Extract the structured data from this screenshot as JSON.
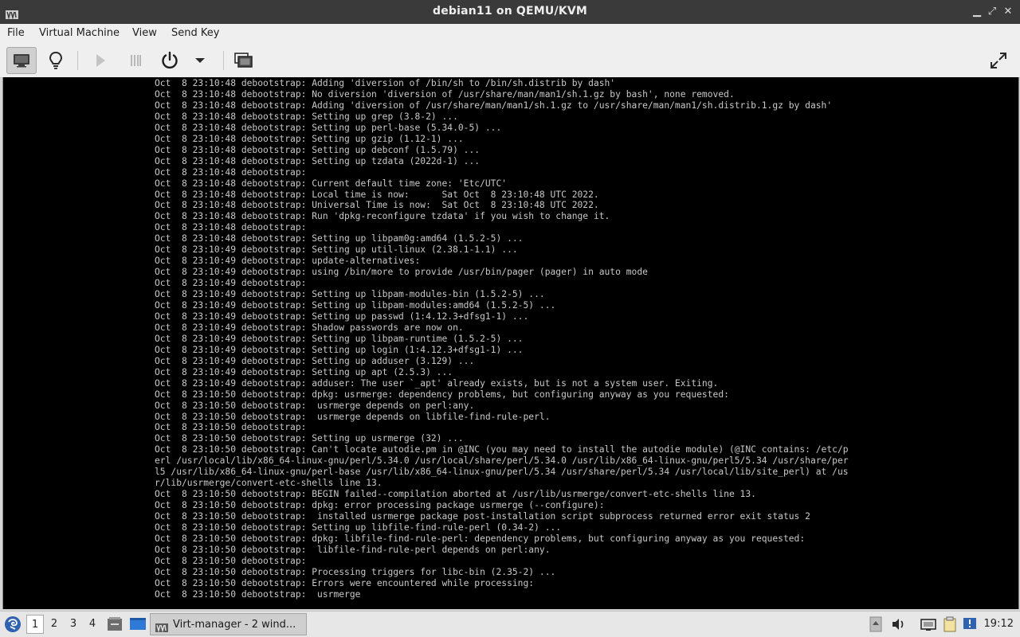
{
  "window": {
    "title": "debian11 on QEMU/KVM",
    "buttons": {
      "minimize": "▁",
      "maximize": "⤢",
      "close": "✕"
    }
  },
  "menu": [
    "File",
    "Virtual Machine",
    "View",
    "Send Key"
  ],
  "toolbar": {
    "icons": [
      "console-icon",
      "lightbulb-icon",
      "play-icon",
      "pause-icon",
      "power-icon",
      "dropdown-arrow-icon",
      "screenshot-icon",
      "fullscreen-icon"
    ]
  },
  "console": {
    "lines": [
      "Oct  8 23:10:48 debootstrap: Adding 'diversion of /bin/sh to /bin/sh.distrib by dash'",
      "Oct  8 23:10:48 debootstrap: No diversion 'diversion of /usr/share/man/man1/sh.1.gz by bash', none removed.",
      "Oct  8 23:10:48 debootstrap: Adding 'diversion of /usr/share/man/man1/sh.1.gz to /usr/share/man/man1/sh.distrib.1.gz by dash'",
      "Oct  8 23:10:48 debootstrap: Setting up grep (3.8-2) ...",
      "Oct  8 23:10:48 debootstrap: Setting up perl-base (5.34.0-5) ...",
      "Oct  8 23:10:48 debootstrap: Setting up gzip (1.12-1) ...",
      "Oct  8 23:10:48 debootstrap: Setting up debconf (1.5.79) ...",
      "Oct  8 23:10:48 debootstrap: Setting up tzdata (2022d-1) ...",
      "Oct  8 23:10:48 debootstrap:",
      "Oct  8 23:10:48 debootstrap: Current default time zone: 'Etc/UTC'",
      "Oct  8 23:10:48 debootstrap: Local time is now:      Sat Oct  8 23:10:48 UTC 2022.",
      "Oct  8 23:10:48 debootstrap: Universal Time is now:  Sat Oct  8 23:10:48 UTC 2022.",
      "Oct  8 23:10:48 debootstrap: Run 'dpkg-reconfigure tzdata' if you wish to change it.",
      "Oct  8 23:10:48 debootstrap:",
      "Oct  8 23:10:48 debootstrap: Setting up libpam0g:amd64 (1.5.2-5) ...",
      "Oct  8 23:10:49 debootstrap: Setting up util-linux (2.38.1-1.1) ...",
      "Oct  8 23:10:49 debootstrap: update-alternatives:",
      "Oct  8 23:10:49 debootstrap: using /bin/more to provide /usr/bin/pager (pager) in auto mode",
      "Oct  8 23:10:49 debootstrap:",
      "Oct  8 23:10:49 debootstrap: Setting up libpam-modules-bin (1.5.2-5) ...",
      "Oct  8 23:10:49 debootstrap: Setting up libpam-modules:amd64 (1.5.2-5) ...",
      "Oct  8 23:10:49 debootstrap: Setting up passwd (1:4.12.3+dfsg1-1) ...",
      "Oct  8 23:10:49 debootstrap: Shadow passwords are now on.",
      "Oct  8 23:10:49 debootstrap: Setting up libpam-runtime (1.5.2-5) ...",
      "Oct  8 23:10:49 debootstrap: Setting up login (1:4.12.3+dfsg1-1) ...",
      "Oct  8 23:10:49 debootstrap: Setting up adduser (3.129) ...",
      "Oct  8 23:10:49 debootstrap: Setting up apt (2.5.3) ...",
      "Oct  8 23:10:49 debootstrap: adduser: The user `_apt' already exists, but is not a system user. Exiting.",
      "Oct  8 23:10:50 debootstrap: dpkg: usrmerge: dependency problems, but configuring anyway as you requested:",
      "Oct  8 23:10:50 debootstrap:  usrmerge depends on perl:any.",
      "Oct  8 23:10:50 debootstrap:  usrmerge depends on libfile-find-rule-perl.",
      "Oct  8 23:10:50 debootstrap:",
      "Oct  8 23:10:50 debootstrap: Setting up usrmerge (32) ...",
      "Oct  8 23:10:50 debootstrap: Can't locate autodie.pm in @INC (you may need to install the autodie module) (@INC contains: /etc/p",
      "erl /usr/local/lib/x86_64-linux-gnu/perl/5.34.0 /usr/local/share/perl/5.34.0 /usr/lib/x86_64-linux-gnu/perl5/5.34 /usr/share/per",
      "l5 /usr/lib/x86_64-linux-gnu/perl-base /usr/lib/x86_64-linux-gnu/perl/5.34 /usr/share/perl/5.34 /usr/local/lib/site_perl) at /us",
      "r/lib/usrmerge/convert-etc-shells line 13.",
      "Oct  8 23:10:50 debootstrap: BEGIN failed--compilation aborted at /usr/lib/usrmerge/convert-etc-shells line 13.",
      "Oct  8 23:10:50 debootstrap: dpkg: error processing package usrmerge (--configure):",
      "Oct  8 23:10:50 debootstrap:  installed usrmerge package post-installation script subprocess returned error exit status 2",
      "Oct  8 23:10:50 debootstrap: Setting up libfile-find-rule-perl (0.34-2) ...",
      "Oct  8 23:10:50 debootstrap: dpkg: libfile-find-rule-perl: dependency problems, but configuring anyway as you requested:",
      "Oct  8 23:10:50 debootstrap:  libfile-find-rule-perl depends on perl:any.",
      "Oct  8 23:10:50 debootstrap:",
      "Oct  8 23:10:50 debootstrap: Processing triggers for libc-bin (2.35-2) ...",
      "Oct  8 23:10:50 debootstrap: Errors were encountered while processing:",
      "Oct  8 23:10:50 debootstrap:  usrmerge"
    ]
  },
  "taskbar": {
    "workspaces": [
      "1",
      "2",
      "3",
      "4"
    ],
    "active_workspace": "1",
    "task_label": "Virt-manager - 2 wind...",
    "clock": "19:12"
  }
}
